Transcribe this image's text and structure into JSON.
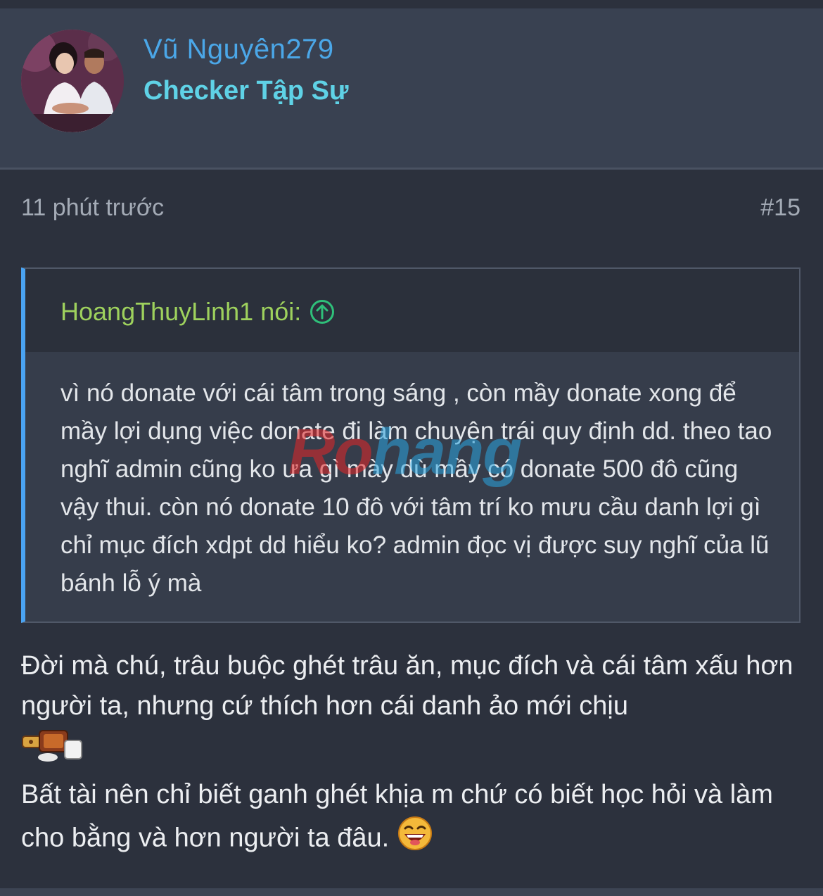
{
  "user": {
    "name": "Vũ Nguyên279",
    "title": "Checker Tập Sự"
  },
  "post": {
    "time": "11 phút trước",
    "number": "#15"
  },
  "quote": {
    "author": "HoangThuyLinh1 nói:",
    "arrow_icon": "arrow-up-circle-icon",
    "text": "vì nó donate với cái tâm trong sáng , còn mầy donate xong để mầy lợi dụng việc donate đi làm chuyện trái quy định dd. theo tao nghĩ admin cũng ko ưa gì mày dù mầy có donate 500 đô cũng vậy thui. còn nó donate 10 đô với tâm trí ko mưu cầu danh lợi gì chỉ mục đích xdpt dd hiểu ko? admin đọc vị được suy nghĩ của lũ bánh lỗ ý mà"
  },
  "watermark": {
    "part1": "Ro",
    "part2": "hang"
  },
  "reply": {
    "line1": "Đời mà chú, trâu buộc ghét trâu ăn, mục đích và cái tâm xấu hơn người ta, nhưng cứ thích hơn cái danh ảo mới chịu",
    "emoji1": "sticker-emoji",
    "line2": "Bất tài nên chỉ biết ganh ghét khịa m chứ có biết học hỏi và làm cho bằng và hơn người ta đâu.",
    "emoji2": "laughing-emoji"
  },
  "colors": {
    "background": "#2c313d",
    "header": "#394151",
    "username": "#4ba7e8",
    "usertitle": "#5fd2e6",
    "quote_author": "#9ed15d",
    "quote_border": "#4aa3f2"
  }
}
